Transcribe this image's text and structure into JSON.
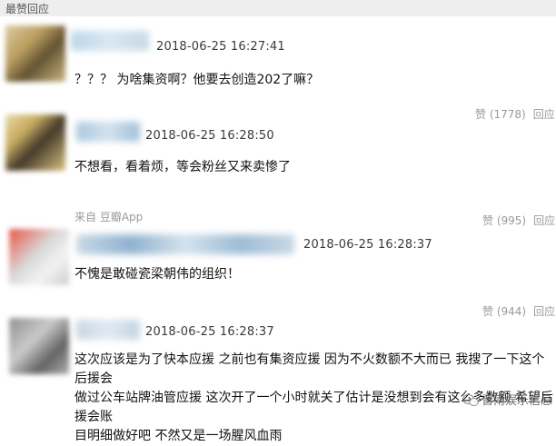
{
  "section": {
    "title": "最赞回应"
  },
  "comments": [
    {
      "timestamp": "2018-06-25 16:27:41",
      "text": "？？？ 为啥集资啊？他要去创造202了嘛？",
      "like_label": "赞 (1778)",
      "reply_label": "回应"
    },
    {
      "timestamp": "2018-06-25 16:28:50",
      "text": "不想看，看着烦，等会粉丝又来卖惨了",
      "like_label": "赞 (995)",
      "reply_label": "回应",
      "source_label": "来自 豆瓣App"
    },
    {
      "timestamp": "2018-06-25 16:28:37",
      "text": "不愧是敢碰瓷梁朝伟的组织！",
      "like_label": "赞 (944)",
      "reply_label": "回应"
    },
    {
      "timestamp": "2018-06-25 16:28:37",
      "lines": [
        "这次应该是为了快本应援 之前也有集资应援 因为不火数额不大而已 我搜了一下这个后援会",
        "做过公车站牌油管应援 这次开了一个小时就关了估计是没想到会有这么多数额 希望后援会账",
        "目明细做好吧 不然又是一场腥风血雨"
      ]
    }
  ],
  "watermark": {
    "text": "晋南娱乐信息"
  }
}
